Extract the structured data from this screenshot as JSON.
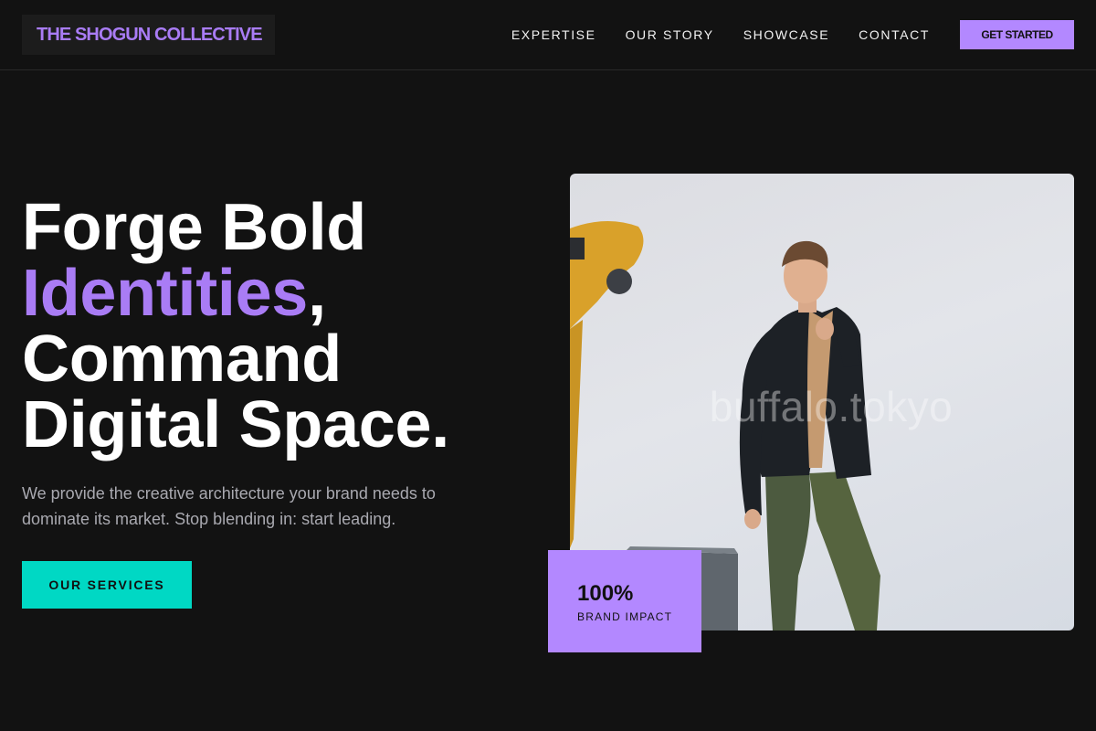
{
  "header": {
    "logo": "THE SHOGUN COLLECTIVE",
    "nav": [
      "EXPERTISE",
      "OUR STORY",
      "SHOWCASE",
      "CONTACT"
    ],
    "cta": "GET STARTED"
  },
  "hero": {
    "title_line1": "Forge Bold",
    "title_accent": "Identities",
    "title_comma": ",",
    "title_line3": "Command",
    "title_line4": "Digital Space.",
    "subtitle": "We provide the creative architecture your brand needs to dominate its market. Stop blending in: start leading.",
    "button": "OUR SERVICES"
  },
  "image": {
    "watermark": "buffalo.tokyo"
  },
  "stat": {
    "value": "100%",
    "label": "BRAND IMPACT"
  },
  "colors": {
    "background": "#121212",
    "accent_purple": "#b388ff",
    "accent_teal": "#00d8c4"
  }
}
